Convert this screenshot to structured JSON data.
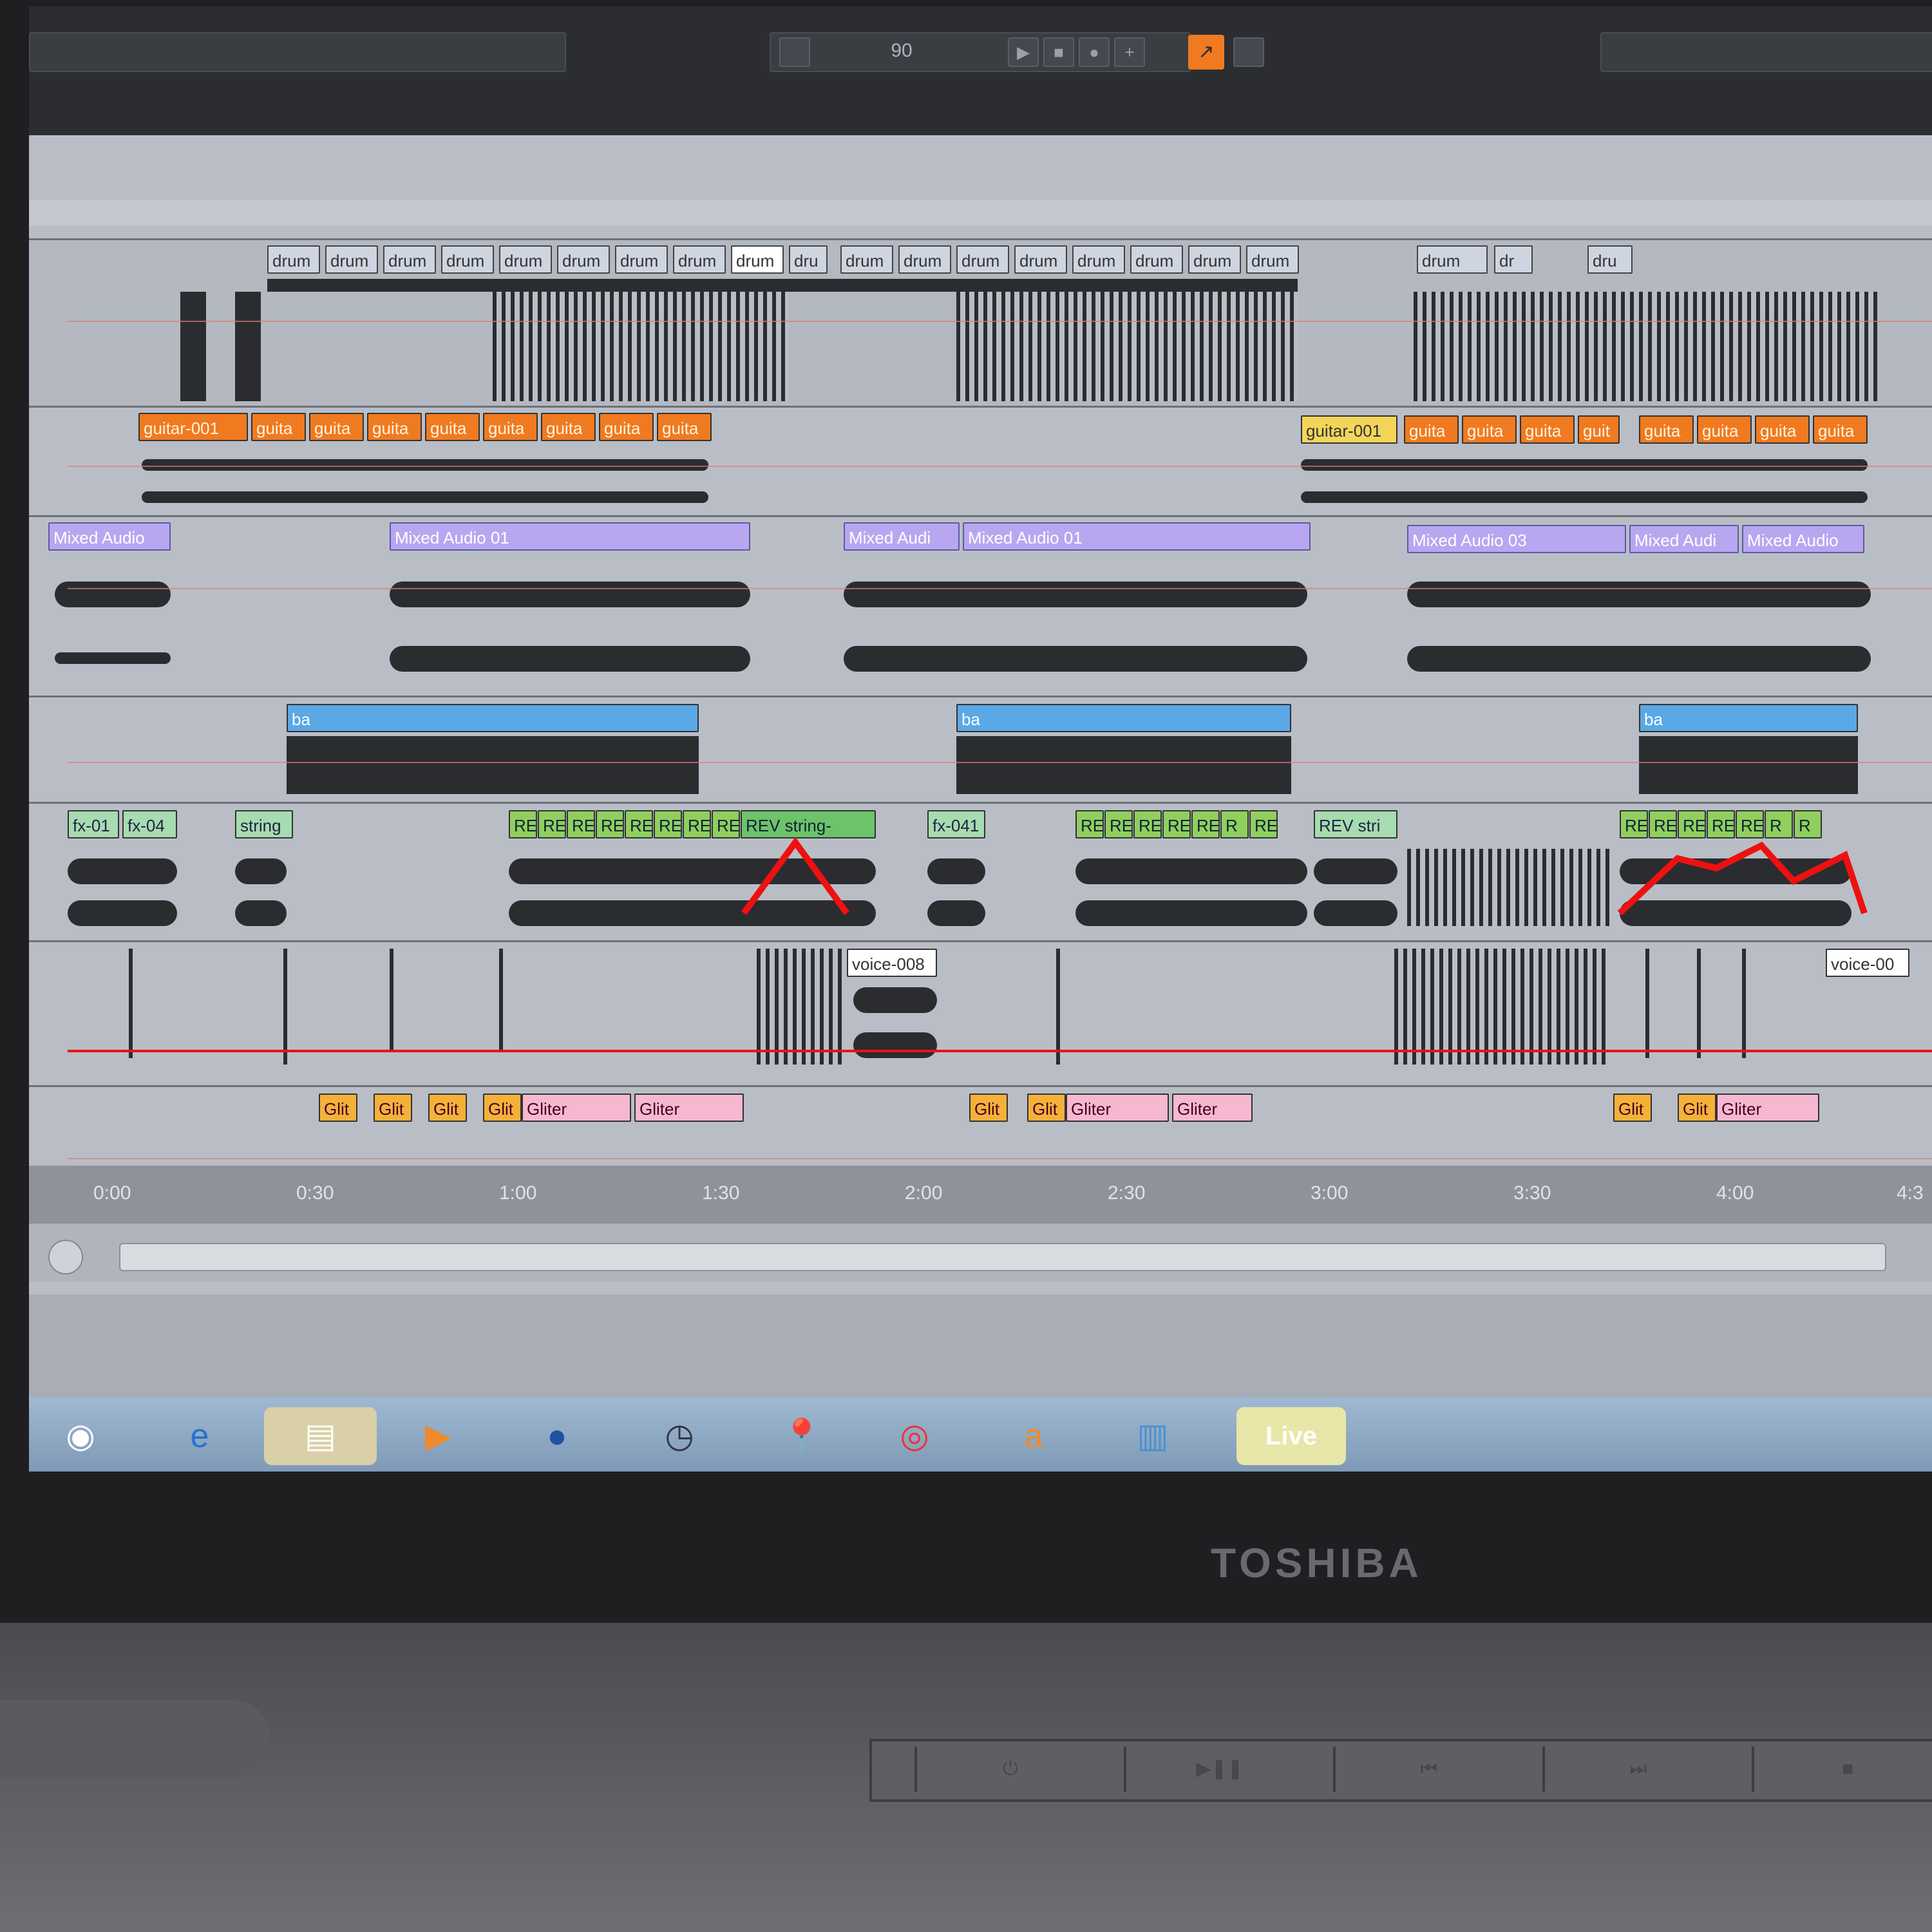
{
  "topbar": {
    "tempo": "90",
    "auto_icon": "automation-arm-icon"
  },
  "tracks": {
    "drums": {
      "clips": [
        "drum",
        "drum",
        "drum",
        "drum",
        "drum",
        "drum",
        "drum",
        "drum",
        "drum",
        "dru",
        "drum",
        "drum",
        "drum",
        "drum",
        "drum",
        "drum",
        "drum",
        "drum",
        "drum",
        "dr",
        "dru"
      ]
    },
    "guitar": {
      "first": "guitar-001",
      "clip": "guita",
      "clip_short": "guit",
      "second": "guitar-001"
    },
    "mixed": {
      "clip_a": "Mixed Audio",
      "clip_b": "Mixed Audio 01",
      "clip_c": "Mixed Audi",
      "clip_d": "Mixed Audio 01",
      "clip_e": "Mixed Audio 03",
      "clip_f": "Mixed Audi",
      "clip_g": "Mixed Audio"
    },
    "bass": {
      "clip": "ba"
    },
    "fx": {
      "fx01": "fx-01",
      "fx04": "fx-04",
      "string": "string",
      "re": "RE",
      "rev_string": "REV string-",
      "fx041": "fx-041",
      "rev_stri": "REV stri",
      "r": "R"
    },
    "voice": {
      "voice008": "voice-008",
      "voice00": "voice-00"
    },
    "glit": {
      "glit": "Glit",
      "gliter": "Gliter"
    }
  },
  "ruler": {
    "ticks": [
      "0:00",
      "0:30",
      "1:00",
      "1:30",
      "2:00",
      "2:30",
      "3:00",
      "3:30",
      "4:00",
      "4:3"
    ]
  },
  "taskbar": {
    "start_icon": "windows-start-icon",
    "ie_icon": "internet-explorer-icon",
    "explorer_icon": "file-explorer-icon",
    "media_icon": "media-player-icon",
    "user_icon": "user-icon",
    "clock_icon": "clock-icon",
    "pin_icon": "pushpin-icon",
    "chrome_icon": "chrome-icon",
    "avast_icon": "avast-icon",
    "notepad_icon": "notepad-icon",
    "live_label": "Live"
  },
  "chassis": {
    "brand": "TOSHIBA"
  }
}
